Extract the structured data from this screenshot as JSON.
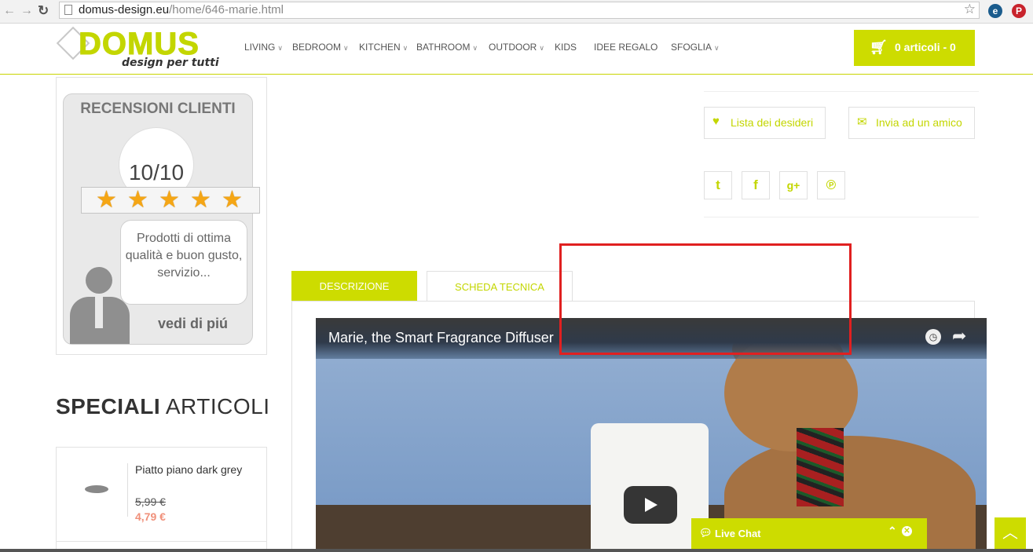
{
  "browser": {
    "url_domain": "domus-design.eu",
    "url_path": "/home/646-marie.html"
  },
  "header": {
    "logo_text": "DOMUS",
    "logo_tagline": "design per tutti",
    "menu": [
      {
        "label": "LIVING",
        "has_dropdown": true
      },
      {
        "label": "BEDROOM",
        "has_dropdown": true
      },
      {
        "label": "KITCHEN",
        "has_dropdown": true
      },
      {
        "label": "BATHROOM",
        "has_dropdown": true
      },
      {
        "label": "OUTDOOR",
        "has_dropdown": true
      },
      {
        "label": "KIDS",
        "has_dropdown": false
      },
      {
        "label": "IDEE REGALO",
        "has_dropdown": false
      },
      {
        "label": "SFOGLIA",
        "has_dropdown": true
      }
    ],
    "cart_label": "0 articoli - 0"
  },
  "reviews": {
    "title": "RECENSIONI CLIENTI",
    "score": "10/10",
    "stars": 5,
    "quote": "Prodotti di ottima qualità e buon gusto, servizio...",
    "see_more": "vedi di piú"
  },
  "specials": {
    "title_bold": "SPECIALI",
    "title_light": "ARTICOLI",
    "product": {
      "name": "Piatto piano dark grey",
      "old_price": "5,99 €",
      "new_price": "4,79 €"
    }
  },
  "actions": {
    "wishlist_label": "Lista dei desideri",
    "send_friend_label": "Invia ad un amico",
    "social": [
      "twitter",
      "facebook",
      "google-plus",
      "pinterest"
    ]
  },
  "tabs": {
    "description": "DESCRIZIONE",
    "technical": "SCHEDA TECNICA"
  },
  "video": {
    "title": "Marie, the Smart Fragrance Diffuser"
  },
  "live_chat": {
    "label": "Live Chat"
  },
  "colors": {
    "accent": "#cddc00",
    "highlight": "#e02020",
    "price_new": "#f0907a"
  }
}
